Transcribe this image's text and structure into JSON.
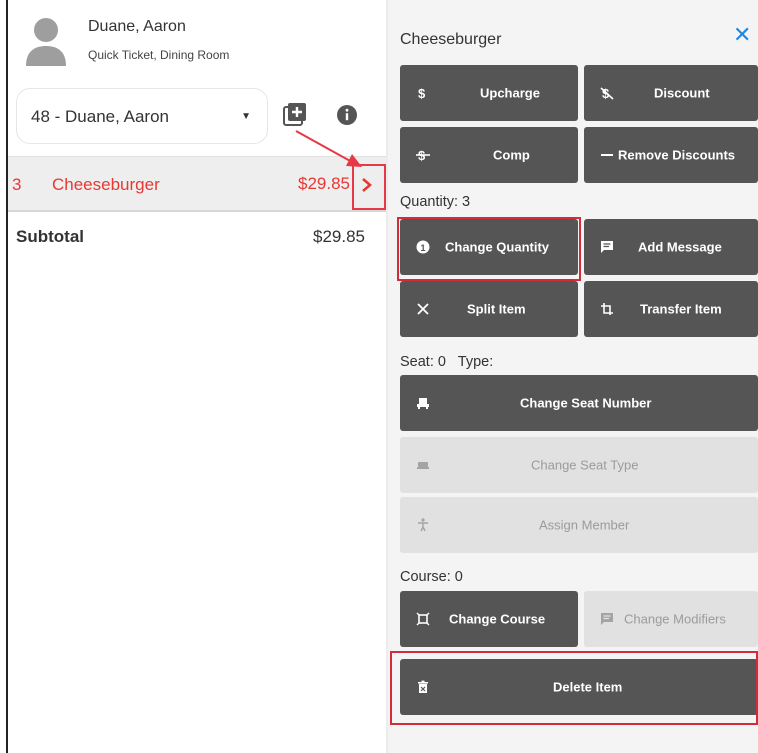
{
  "customer": {
    "name": "Duane, Aaron",
    "subtitle": "Quick Ticket, Dining Room"
  },
  "ticket_select": {
    "value": "48 - Duane, Aaron"
  },
  "order_item": {
    "quantity": "3",
    "name": "Cheeseburger",
    "price": "$29.85"
  },
  "subtotal": {
    "label": "Subtotal",
    "value": "$29.85"
  },
  "panel": {
    "title": "Cheeseburger",
    "close_icon": "close-icon",
    "upcharge": "Upcharge",
    "discount": "Discount",
    "comp": "Comp",
    "remove_discounts": "Remove Discounts",
    "quantity_label": "Quantity: 3",
    "change_quantity": "Change Quantity",
    "add_message": "Add Message",
    "split_item": "Split Item",
    "transfer_item": "Transfer Item",
    "seat_label": "Seat: 0   Type:",
    "change_seat_number": "Change Seat Number",
    "change_seat_type": "Change Seat Type",
    "assign_member": "Assign Member",
    "course_label": "Course: 0",
    "change_course": "Change Course",
    "change_modifiers": "Change Modifiers",
    "delete_item": "Delete Item"
  },
  "colors": {
    "button_dark": "#555555",
    "button_disabled": "#e1e1e1",
    "item_red": "#e53935",
    "annotation_red": "#d22c3a",
    "close_blue": "#1e88e5"
  }
}
